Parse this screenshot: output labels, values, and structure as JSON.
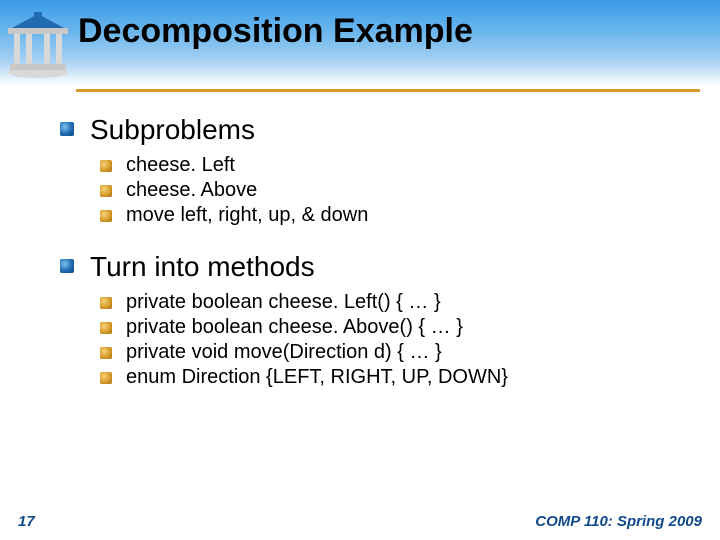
{
  "title": "Decomposition Example",
  "sections": [
    {
      "heading": "Subproblems",
      "items": [
        "cheese. Left",
        "cheese. Above",
        "move left, right, up, & down"
      ]
    },
    {
      "heading": "Turn into methods",
      "items": [
        "private boolean cheese. Left() { … }",
        "private boolean cheese. Above() { … }",
        "private void move(Direction d) { … }",
        "enum Direction {LEFT, RIGHT, UP, DOWN}"
      ]
    }
  ],
  "footer": {
    "page": "17",
    "course": "COMP 110: Spring 2009"
  }
}
